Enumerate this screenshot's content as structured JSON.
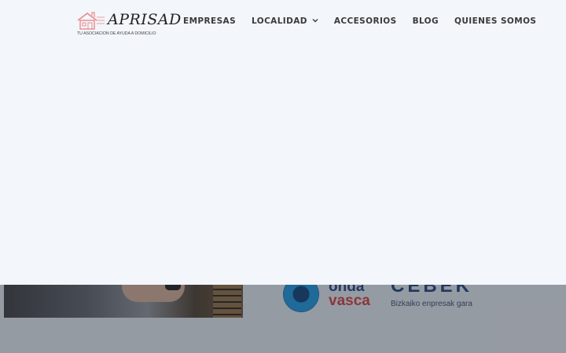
{
  "brand": {
    "name": "APRISAD",
    "tagline": "TU ASOCIACION DE AYUDA A DOMICILIO",
    "accent_color": "#e88a8a"
  },
  "nav": {
    "items": [
      {
        "label": "EMPRESAS"
      },
      {
        "label": "LOCALIDAD",
        "has_dropdown": true,
        "icon": "chevron-down-icon"
      },
      {
        "label": "ACCESORIOS"
      },
      {
        "label": "BLOG"
      },
      {
        "label": "QUIENES SOMOS"
      }
    ]
  },
  "sponsors": {
    "onda_line1": "onda",
    "onda_line2": "vasca",
    "cebek_name": "CEBEK",
    "cebek_sub": "Bizkaiko enpresak gara"
  },
  "colors": {
    "panel_bg": "#f3f6fb",
    "overlay": "#28303c"
  }
}
